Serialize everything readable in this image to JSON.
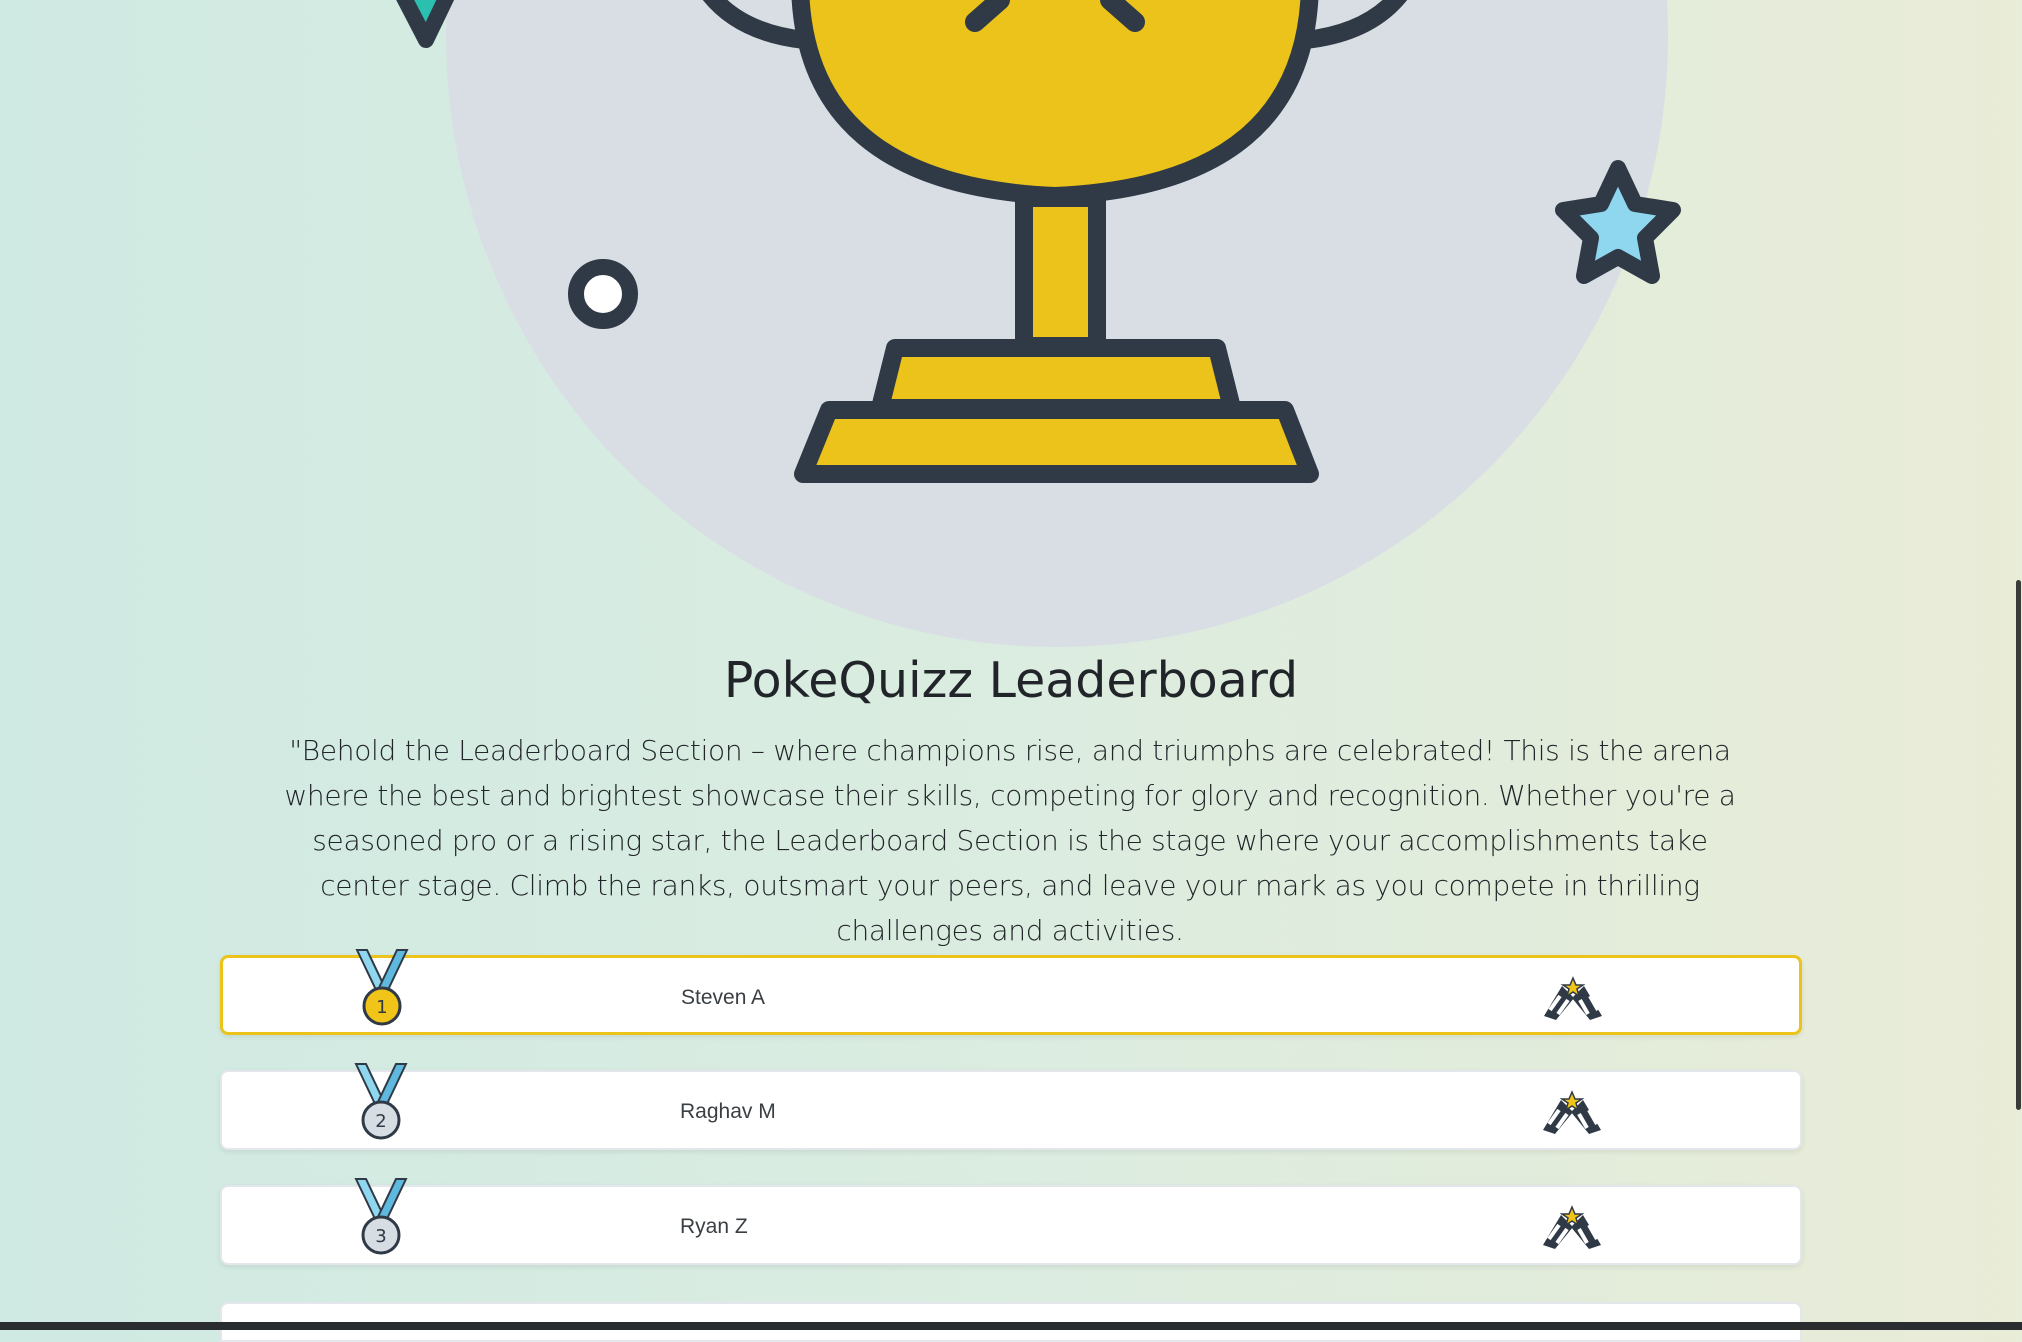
{
  "hero": {
    "title": "PokeQuizz Leaderboard",
    "description": "\"Behold the Leaderboard Section – where champions rise, and triumphs are celebrated! This is the arena where the best and brightest showcase their skills, competing for glory and recognition. Whether you're a seasoned pro or a rising star, the Leaderboard Section is the stage where your accomplishments take center stage. Climb the ranks, outsmart your peers, and leave your mark as you compete in thrilling challenges and activities."
  },
  "leaderboard": {
    "entries": [
      {
        "rank": "1",
        "name": "Steven A",
        "medal": "gold-medal-icon",
        "medal_color": "#f0c419"
      },
      {
        "rank": "2",
        "name": "Raghav M",
        "medal": "silver-medal-icon",
        "medal_color": "#d6dde3"
      },
      {
        "rank": "3",
        "name": "Ryan Z",
        "medal": "bronze-medal-icon",
        "medal_color": "#d6dde3"
      }
    ],
    "trailing_icon": "checkered-flags-icon"
  },
  "colors": {
    "trophy": "#ecc31a",
    "outline": "#2f3a46",
    "circle_bg": "#d9dee5",
    "highlight_border": "#ecc31a",
    "star_fill": "#8fd6ef"
  }
}
